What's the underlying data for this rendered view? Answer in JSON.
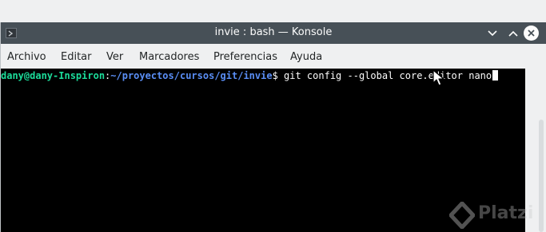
{
  "window": {
    "title": "invie : bash — Konsole"
  },
  "menubar": {
    "items": [
      "Archivo",
      "Editar",
      "Ver",
      "Marcadores",
      "Preferencias",
      "Ayuda"
    ]
  },
  "terminal": {
    "prompt_user": "dany@dany-Inspiron",
    "prompt_sep": ":",
    "prompt_path": "~/proyectos/cursos/git/invie",
    "prompt_symbol": "$ ",
    "command": "git config --global core.editor nano",
    "colors": {
      "background": "#000000",
      "user": "#1cdc9a",
      "path": "#5a8ef5",
      "text": "#fcfcfc"
    }
  },
  "watermark": {
    "text": "Platzi"
  },
  "icons": [
    "konsole-app-icon",
    "chevron-down-icon",
    "chevron-up-icon",
    "close-icon",
    "mouse-pointer-icon",
    "platzi-logo-icon"
  ]
}
